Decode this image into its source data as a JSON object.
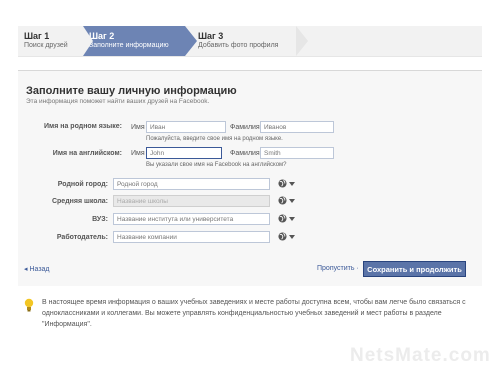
{
  "steps": [
    {
      "title": "Шаг 1",
      "subtitle": "Поиск друзей"
    },
    {
      "title": "Шаг 2",
      "subtitle": "Заполните информацию"
    },
    {
      "title": "Шаг 3",
      "subtitle": "Добавить фото профиля"
    }
  ],
  "form": {
    "title": "Заполните вашу личную информацию",
    "subtitle": "Эта информация поможет найти ваших друзей на Facebook.",
    "native_name_label": "Имя на родном языке:",
    "first_name_label": "Имя",
    "first_name_value": "Иван",
    "last_name_label": "Фамилия",
    "last_name_value": "Иванов",
    "native_hint": "Пожалуйста, введите свое имя на родном языке.",
    "english_name_label": "Имя на английском:",
    "en_first_name_placeholder": "John",
    "en_last_name_value": "Smith",
    "english_hint": "Вы указали свое имя на Facebook на английском?",
    "city_label": "Родной город:",
    "city_placeholder": "Родной город",
    "school_label": "Средняя школа:",
    "school_placeholder": "Название школы",
    "university_label": "ВУЗ:",
    "university_placeholder": "Название института или университета",
    "employer_label": "Работодатель:",
    "employer_placeholder": "Название компании",
    "back_label": "◂ Назад",
    "skip_label": "Пропустить ·",
    "save_label": "Сохранить и продолжить"
  },
  "info_text": "В настоящее время информация о ваших учебных заведениях и месте работы доступна всем, чтобы вам легче было связаться с одноклассниками и коллегами. Вы можете управлять конфиденциальностью учебных заведений и мест работы в разделе \"Информация\".",
  "watermark": "NetsMate.com",
  "colors": {
    "accent": "#6d84b4",
    "button": "#5b74a8",
    "link": "#3b5998"
  },
  "icons": {
    "privacy": "globe-icon",
    "tip": "lightbulb-icon"
  }
}
